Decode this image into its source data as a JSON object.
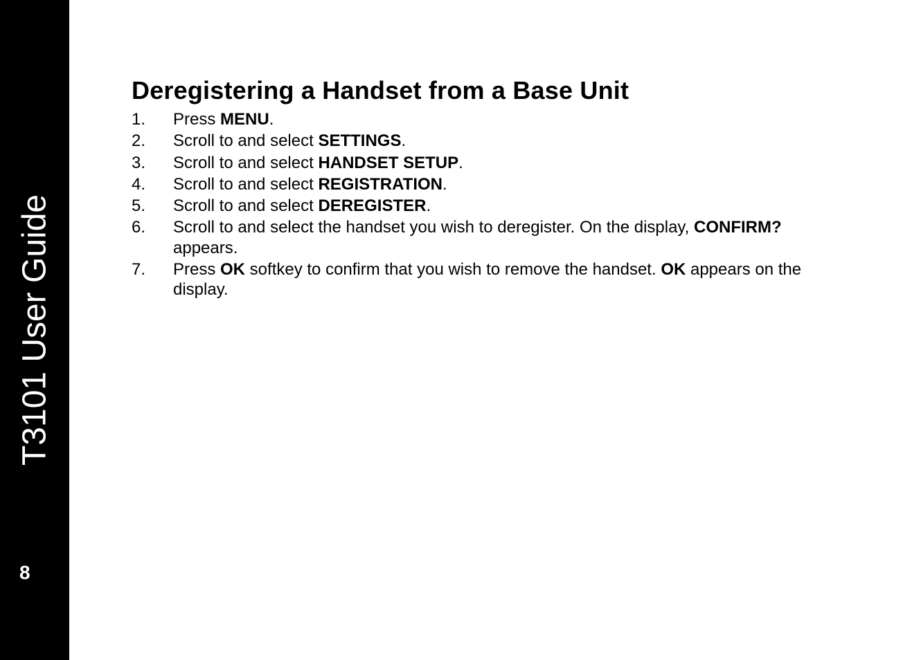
{
  "sidebar": {
    "title": "T3101 User Guide",
    "page_number": "8"
  },
  "content": {
    "heading": "Deregistering a Handset from a Base Unit",
    "steps": [
      {
        "segments": [
          {
            "text": "Press ",
            "bold": false
          },
          {
            "text": "MENU",
            "bold": true
          },
          {
            "text": ".",
            "bold": false
          }
        ]
      },
      {
        "segments": [
          {
            "text": "Scroll to and select ",
            "bold": false
          },
          {
            "text": "SETTINGS",
            "bold": true
          },
          {
            "text": ".",
            "bold": false
          }
        ]
      },
      {
        "segments": [
          {
            "text": "Scroll to and select ",
            "bold": false
          },
          {
            "text": "HANDSET SETUP",
            "bold": true
          },
          {
            "text": ".",
            "bold": false
          }
        ]
      },
      {
        "segments": [
          {
            "text": "Scroll to and select ",
            "bold": false
          },
          {
            "text": "REGISTRATION",
            "bold": true
          },
          {
            "text": ".",
            "bold": false
          }
        ]
      },
      {
        "segments": [
          {
            "text": "Scroll to and select ",
            "bold": false
          },
          {
            "text": "DEREGISTER",
            "bold": true
          },
          {
            "text": ".",
            "bold": false
          }
        ]
      },
      {
        "segments": [
          {
            "text": "Scroll to and select the handset you wish to deregister. On the display, ",
            "bold": false
          },
          {
            "text": "CONFIRM?",
            "bold": true
          },
          {
            "text": " appears.",
            "bold": false
          }
        ]
      },
      {
        "segments": [
          {
            "text": "Press ",
            "bold": false
          },
          {
            "text": "OK",
            "bold": true
          },
          {
            "text": " softkey to confirm that you wish to remove the handset. ",
            "bold": false
          },
          {
            "text": "OK",
            "bold": true
          },
          {
            "text": " appears on the display.",
            "bold": false
          }
        ]
      }
    ]
  }
}
